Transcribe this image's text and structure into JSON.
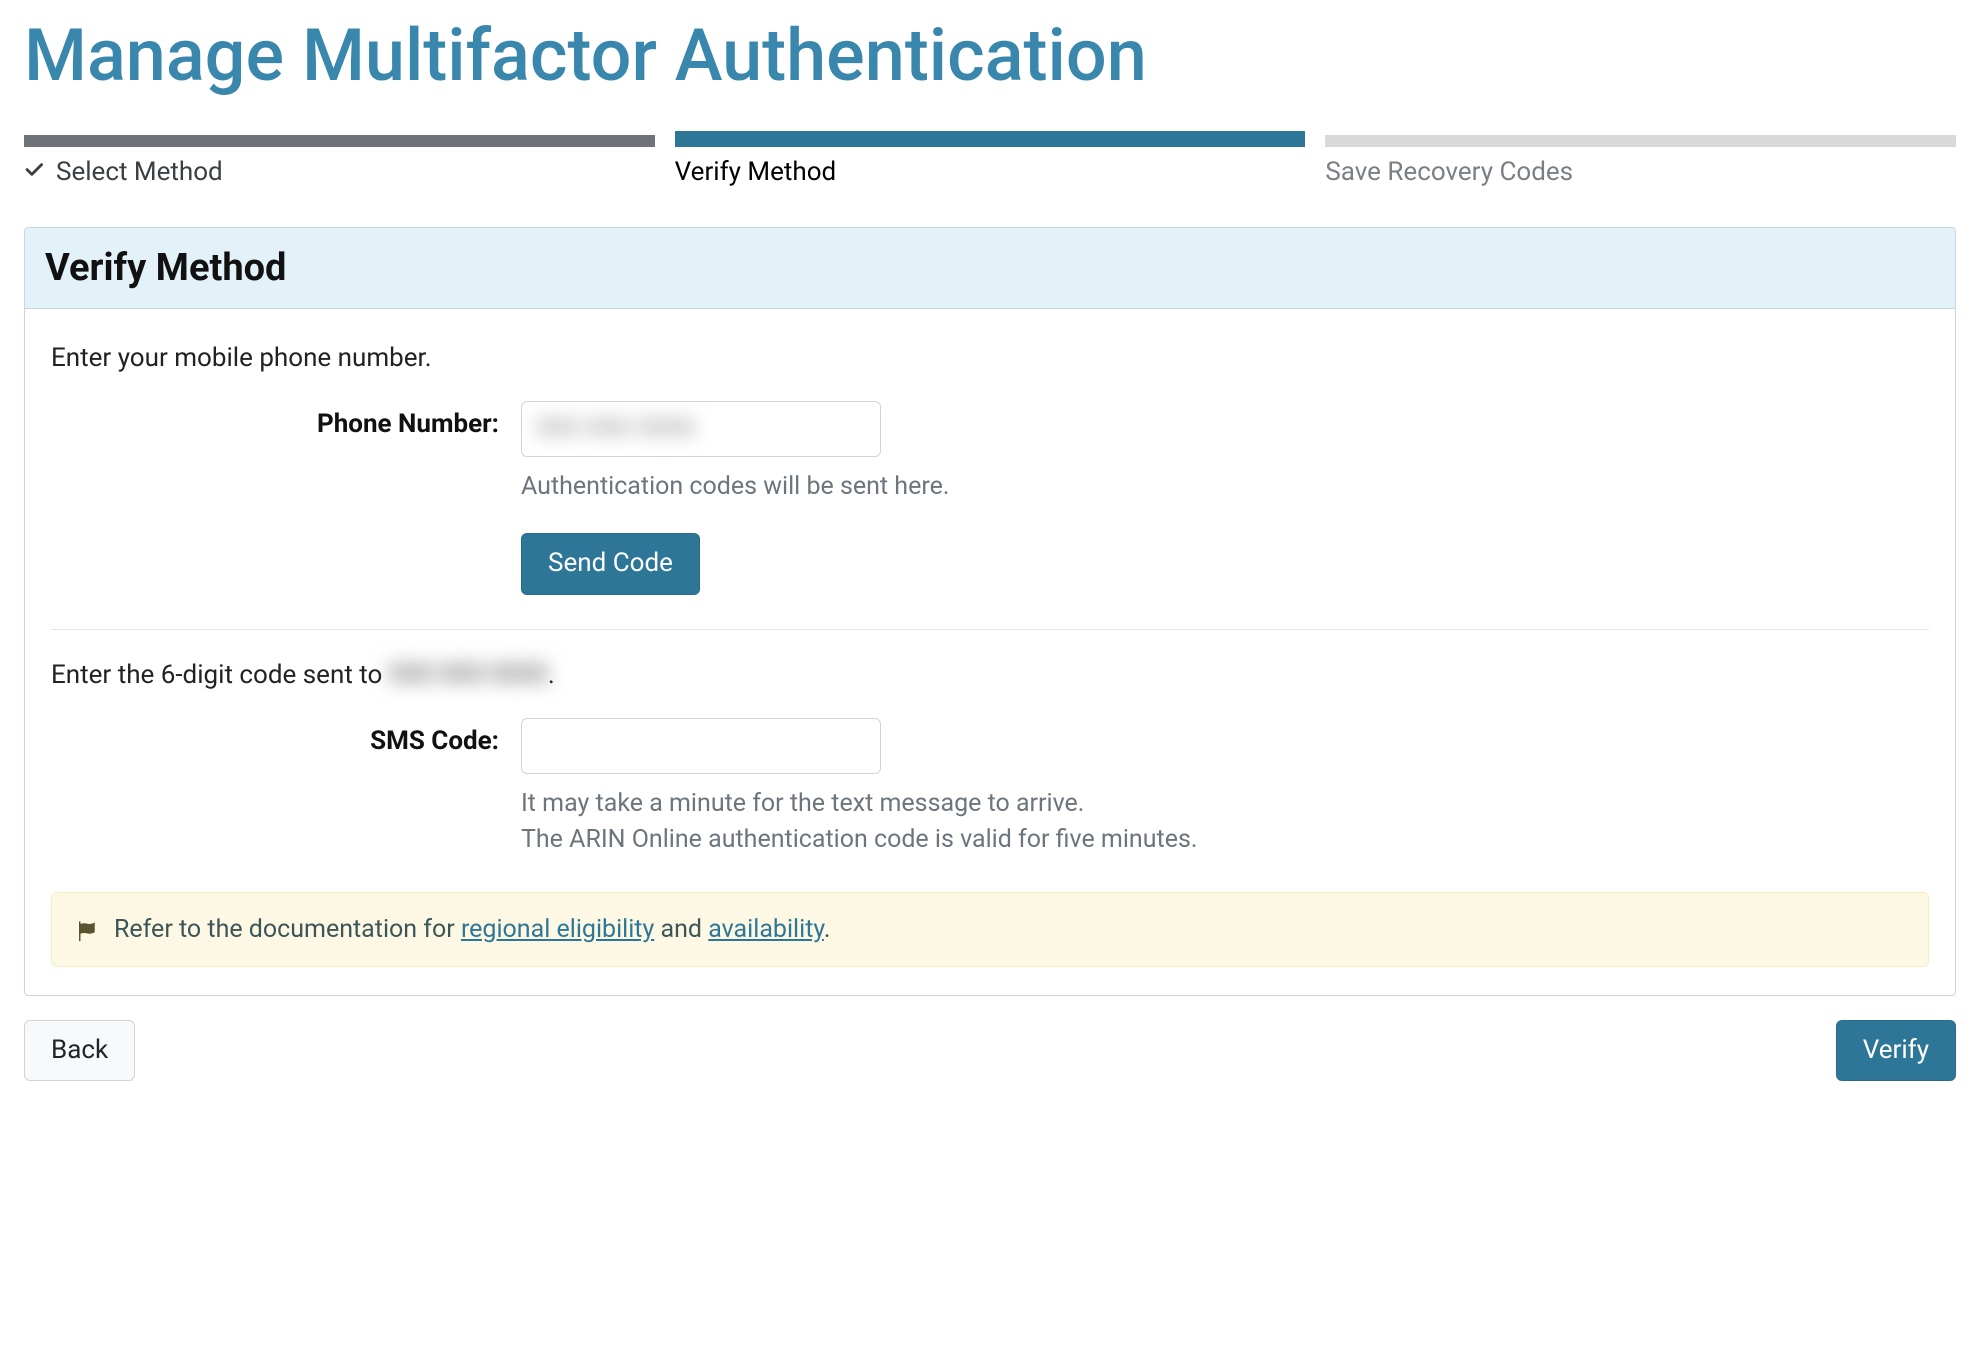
{
  "page": {
    "title": "Manage Multifactor Authentication"
  },
  "stepper": {
    "steps": [
      {
        "label": "Select Method",
        "state": "completed"
      },
      {
        "label": "Verify Method",
        "state": "active"
      },
      {
        "label": "Save Recovery Codes",
        "state": "upcoming"
      }
    ]
  },
  "panel": {
    "title": "Verify Method",
    "phone_section": {
      "instruction": "Enter your mobile phone number.",
      "label": "Phone Number:",
      "value_masked": "999 999 9999",
      "help": "Authentication codes will be sent here.",
      "send_button": "Send Code"
    },
    "code_section": {
      "instruction_prefix": "Enter the 6-digit code sent to ",
      "instruction_masked": "999 999 9999",
      "instruction_suffix": ".",
      "label": "SMS Code:",
      "value": "",
      "help_line1": "It may take a minute for the text message to arrive.",
      "help_line2": "The ARIN Online authentication code is valid for five minutes."
    },
    "alert": {
      "prefix": "Refer to the documentation for ",
      "link1": "regional eligibility",
      "middle": " and ",
      "link2": "availability",
      "suffix": "."
    }
  },
  "footer": {
    "back": "Back",
    "verify": "Verify"
  }
}
